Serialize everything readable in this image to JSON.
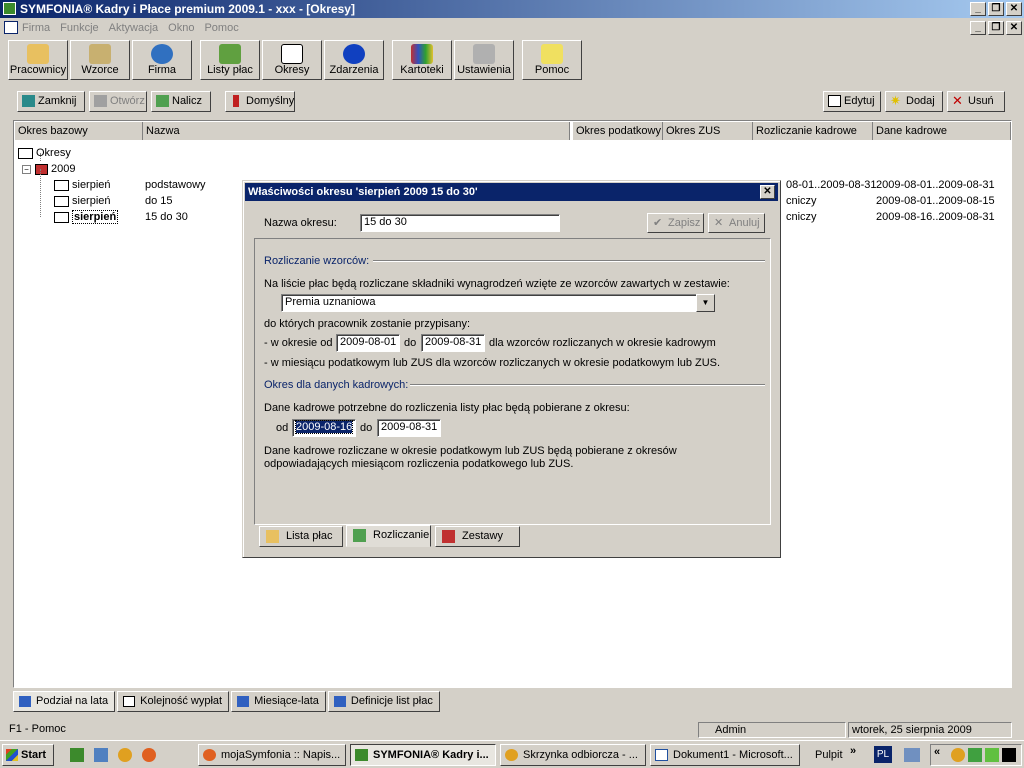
{
  "window": {
    "title": "SYMFONIA® Kadry i Płace premium 2009.1 - xxx - [Okresy]"
  },
  "menu": [
    "Firma",
    "Funkcje",
    "Aktywacja",
    "Okno",
    "Pomoc"
  ],
  "toolbar": {
    "pracownicy": "Pracownicy",
    "wzorce": "Wzorce",
    "firma": "Firma",
    "listy_plac": "Listy płac",
    "okresy": "Okresy",
    "zdarzenia": "Zdarzenia",
    "kartoteki": "Kartoteki",
    "ustawienia": "Ustawienia",
    "pomoc": "Pomoc"
  },
  "actions": {
    "zamknij": "Zamknij",
    "otworz": "Otwórz",
    "nalicz": "Nalicz",
    "domyslny": "Domyślny",
    "edytuj": "Edytuj",
    "dodaj": "Dodaj",
    "usun": "Usuń"
  },
  "columns": {
    "okres_bazowy": "Okres bazowy",
    "nazwa": "Nazwa",
    "okres_podatkowy": "Okres podatkowy",
    "okres_zus": "Okres ZUS",
    "rozliczanie_kadrowe": "Rozliczanie kadrowe",
    "dane_kadrowe": "Dane kadrowe"
  },
  "tree": {
    "root": "Okresy",
    "year": "2009",
    "rows": [
      {
        "label": "sierpień",
        "nazwa": "podstawowy",
        "rk": "08-01..2009-08-31",
        "dk": "2009-08-01..2009-08-31"
      },
      {
        "label": "sierpień",
        "nazwa": "do 15",
        "rk": "cniczy",
        "dk": "2009-08-01..2009-08-15"
      },
      {
        "label": "sierpień",
        "nazwa": "15 do 30",
        "rk": "cniczy",
        "dk": "2009-08-16..2009-08-31"
      }
    ]
  },
  "bottom_tabs": [
    "Podział na lata",
    "Kolejność wypłat",
    "Miesiące-lata",
    "Definicje list płac"
  ],
  "status": {
    "help": "F1 - Pomoc",
    "user": "Admin",
    "date": "wtorek, 25 sierpnia 2009"
  },
  "taskbar": {
    "start": "Start",
    "tasks": [
      "mojaSymfonia :: Napis...",
      "SYMFONIA® Kadry i...",
      "Skrzynka odbiorcza - ...",
      "Dokument1 - Microsoft..."
    ],
    "pulpit": "Pulpit",
    "lang": "PL"
  },
  "dialog": {
    "title": "Właściwości okresu 'sierpień 2009 15 do 30'",
    "name_label": "Nazwa okresu:",
    "name_value": "15 do 30",
    "zapisz": "Zapisz",
    "anuluj": "Anuluj",
    "group1": "Rozliczanie wzorców:",
    "text1": "Na liście płac będą rozliczane składniki wynagrodzeń wzięte ze wzorców zawartych w zestawie:",
    "zestaw_value": "Premia uznaniowa",
    "text2": "do których pracownik zostanie przypisany:",
    "w_okresie_od": "- w okresie od",
    "od_value": "2009-08-01",
    "do_label": "do",
    "do_value": "2009-08-31",
    "text3": "dla wzorców rozliczanych w okresie kadrowym",
    "text4": "- w miesiącu podatkowym lub ZUS dla wzorców rozliczanych w okresie podatkowym lub ZUS.",
    "group2": "Okres dla danych kadrowych:",
    "text5": "Dane kadrowe potrzebne do rozliczenia listy płac będą pobierane z okresu:",
    "od_label": "od",
    "od2_value": "2009-08-16",
    "do2_value": "2009-08-31",
    "text6a": "Dane kadrowe rozliczane w okresie podatkowym lub ZUS będą pobierane z okresów",
    "text6b": "odpowiadających miesiącom rozliczenia podatkowego lub ZUS.",
    "tabs": [
      "Lista płac",
      "Rozliczanie",
      "Zestawy"
    ]
  }
}
